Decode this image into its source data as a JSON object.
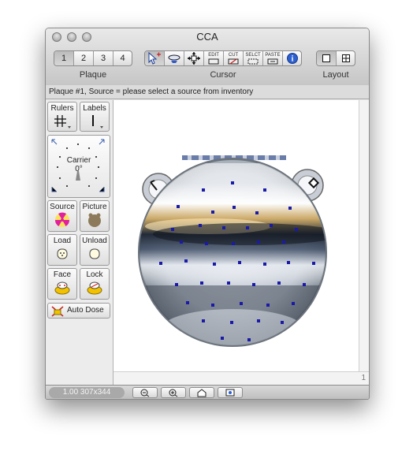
{
  "window": {
    "title": "CCA"
  },
  "toolbar": {
    "plaque": {
      "label": "Plaque",
      "items": [
        "1",
        "2",
        "3",
        "4"
      ],
      "selected": "1"
    },
    "cursor": {
      "label": "Cursor",
      "items": [
        "EDIT",
        "CUT",
        "SELCT",
        "PASTE"
      ]
    },
    "layout": {
      "label": "Layout"
    }
  },
  "status": {
    "text": "Plaque #1, Source = please select a source from inventory"
  },
  "sidebar": {
    "rulers": "Rulers",
    "labels": "Labels",
    "carrier": {
      "label": "Carrier",
      "angle": "0°"
    },
    "source": "Source",
    "picture": "Picture",
    "load": "Load",
    "unload": "Unload",
    "face": "Face",
    "lock": "Lock",
    "auto_dose": "Auto Dose"
  },
  "scroll": {
    "corner_number": "1"
  },
  "bottom": {
    "zoom_info": "1.00 307x344"
  },
  "colors": {
    "seed_marker": "#1a1aa8",
    "accent_info": "#2d5fd0",
    "radiation": "#e2209e"
  }
}
